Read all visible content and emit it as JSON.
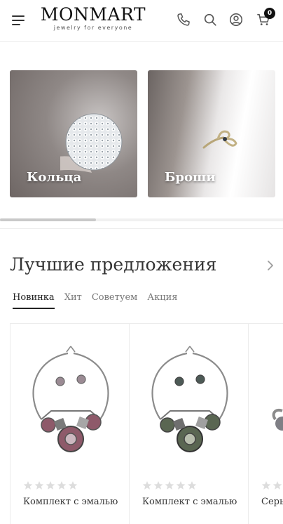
{
  "header": {
    "logo_title": "MONMART",
    "logo_subtitle": "jewelry for everyone",
    "cart_count": "0",
    "icons": [
      "menu-icon",
      "phone-icon",
      "search-icon",
      "user-icon",
      "cart-icon"
    ]
  },
  "categories": [
    {
      "label": "Кольца"
    },
    {
      "label": "Броши"
    }
  ],
  "carousel_progress": 0.34,
  "section": {
    "title": "Лучшие предложения",
    "tabs": [
      {
        "label": "Новинка",
        "active": true
      },
      {
        "label": "Хит",
        "active": false
      },
      {
        "label": "Советуем",
        "active": false
      },
      {
        "label": "Акция",
        "active": false
      }
    ]
  },
  "products": [
    {
      "name": "Комплект с эмалью",
      "rating": 0,
      "accent": "#8e5a6a"
    },
    {
      "name": "Комплект с эмалью",
      "rating": 0,
      "accent": "#5a6652"
    },
    {
      "name": "Серь",
      "rating": 0,
      "accent": "#7f7f85"
    }
  ],
  "colors": {
    "text": "#333333",
    "star_empty": "#dddddd",
    "badge": "#111111"
  }
}
